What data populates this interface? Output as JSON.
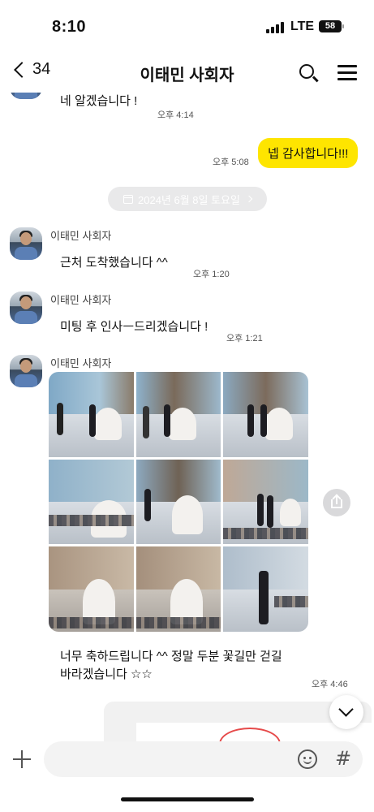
{
  "status_bar": {
    "time": "8:10",
    "network": "LTE",
    "battery": "58"
  },
  "header": {
    "back_count": "34",
    "title": "이태민 사회자"
  },
  "messages": [
    {
      "id": "m1",
      "direction": "in",
      "text": "네 알겠습니다 !",
      "time": "오후 4:14"
    },
    {
      "id": "m2",
      "direction": "out",
      "text": "넵 감사합니다!!!",
      "time": "오후 5:08"
    },
    {
      "id": "date",
      "type": "date",
      "text": "2024년 6월 8일 토요일"
    },
    {
      "id": "m3",
      "direction": "in",
      "sender": "이태민 사회자",
      "text": "근처 도착했습니다 ^^",
      "time": "오후 1:20"
    },
    {
      "id": "m4",
      "direction": "in",
      "sender": "이태민 사회자",
      "text": "미팅 후 인사ㅡ드리겠습니다 !",
      "time": "오후 1:21"
    },
    {
      "id": "m5",
      "direction": "in",
      "sender": "이태민 사회자",
      "type": "photo_grid",
      "photo_count": 9
    },
    {
      "id": "m6",
      "direction": "in",
      "text": "너무 축하드립니다 ^^ 정말 두분 꽃길만 걷길 바라겠습니다 ☆☆",
      "time": "오후 4:46"
    }
  ],
  "input": {
    "value": "",
    "placeholder": ""
  },
  "icons": {
    "back": "chevron-left-icon",
    "search": "search-icon",
    "menu": "hamburger-menu-icon",
    "add": "plus-icon",
    "emoji": "emoji-icon",
    "hashtag": "hashtag-icon",
    "share": "share-icon",
    "scroll_down": "chevron-down-icon",
    "calendar": "calendar-icon"
  },
  "colors": {
    "outgoing_bubble": "#fee500",
    "incoming_bubble": "#ffffff",
    "background": "#ffffff",
    "date_pill": "#e9e9ea"
  }
}
